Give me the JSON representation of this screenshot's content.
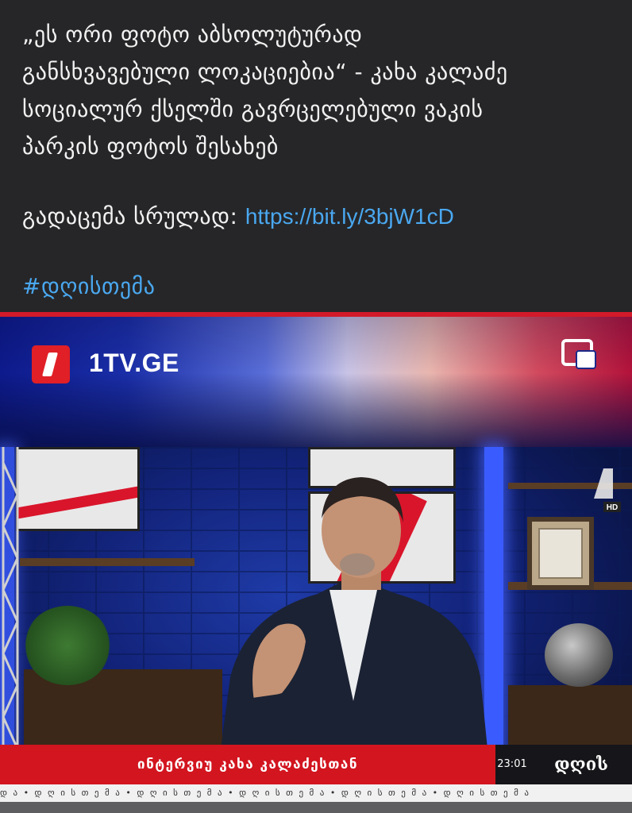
{
  "post": {
    "line1": "„ეს ორი ფოტო აბსოლუტურად",
    "line2": "განსხვავებული ლოკაციებია“ - კახა კალაძე",
    "line3": "სოციალურ ქსელში გავრცელებული ვაკის",
    "line4": "პარკის ფოტოს შესახებ",
    "broadcast_label": "გადაცემა სრულად: ",
    "broadcast_link": "https://bit.ly/3bjW1cD",
    "hashtag": "#დღისთემა"
  },
  "video": {
    "channel_name": "1TV.GE",
    "pip_icon": "picture-in-picture-icon",
    "logo_icon": "first-channel-logo-icon",
    "hd_label": "HD",
    "ticker_text": "ინტერვიუ კახა კალაძესთან",
    "ticker_time": "23:01",
    "show_title": "დღის თემა",
    "crawl_text": "დ ა • დ ღ ი ს თ ე მ ა • დ ღ ი ს თ ე მ ა • დ ღ ი ს თ ე მ ა • დ ღ ი ს თ ე მ ა • დ ღ ი ს თ ე მ ა"
  },
  "colors": {
    "background": "#262628",
    "link": "#4aa8f0",
    "ticker_red": "#d2151f",
    "logo_red": "#e01f26"
  }
}
